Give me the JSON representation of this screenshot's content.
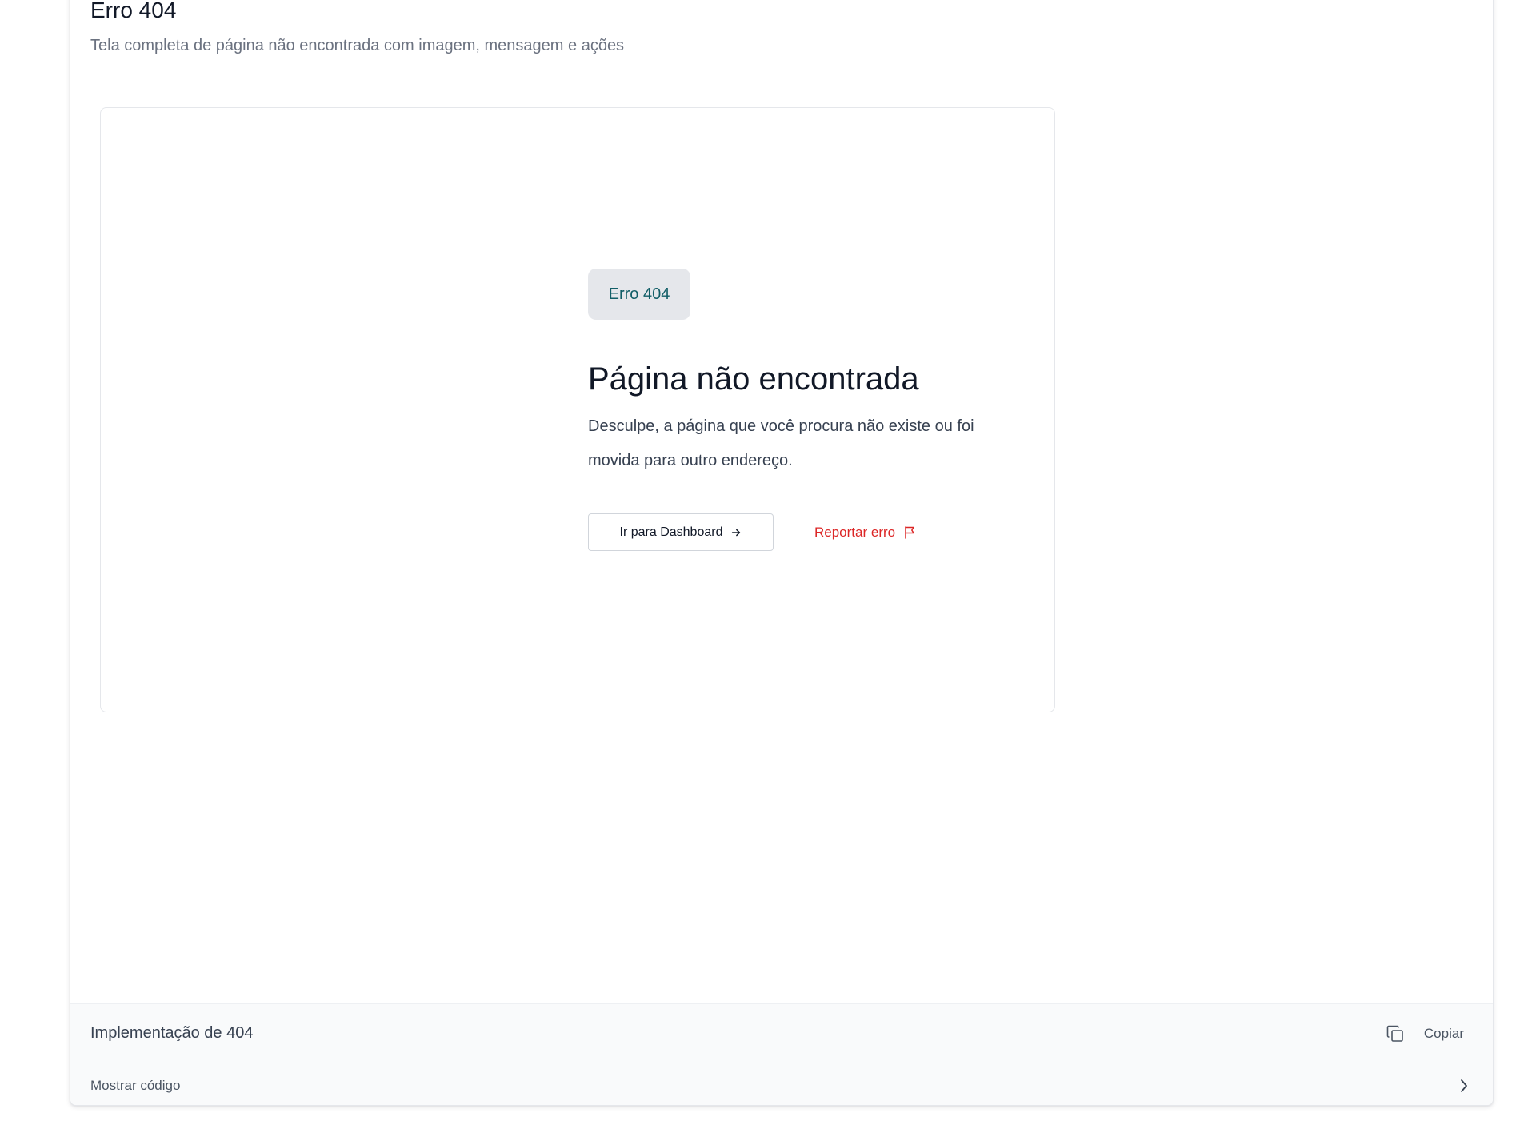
{
  "header": {
    "title": "Erro 404",
    "subtitle": "Tela completa de página não encontrada com imagem, mensagem e ações"
  },
  "preview": {
    "badge": "Erro 404",
    "headline": "Página não encontrada",
    "message": "Desculpe, a página que você procura não existe ou foi movida para outro endereço.",
    "primary_action": {
      "label": "Ir para Dashboard",
      "icon": "arrow-right-icon"
    },
    "secondary_action": {
      "label": "Reportar erro",
      "icon": "flag-icon"
    }
  },
  "code_section": {
    "title": "Implementação de 404",
    "copy_label": "Copiar",
    "copy_icon": "copy-icon",
    "toggle_label": "Mostrar código",
    "toggle_icon": "chevron-right-icon"
  },
  "colors": {
    "accent_teal": "#115e67",
    "danger_red": "#dc2626",
    "badge_bg": "#e5e7eb",
    "border": "#e5e7eb",
    "footer_bg": "#f9fafb"
  }
}
